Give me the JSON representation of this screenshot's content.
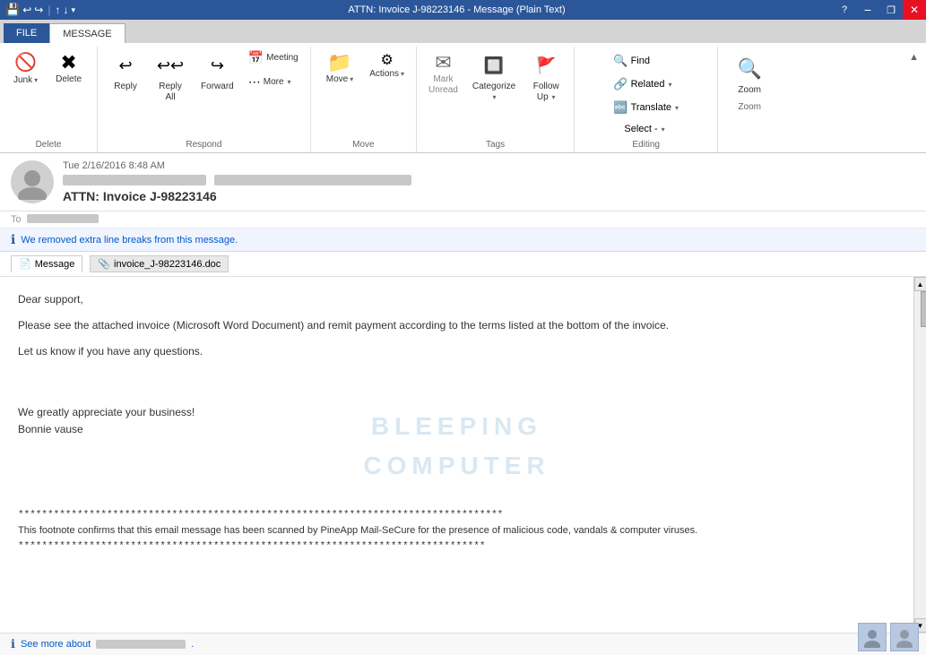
{
  "window": {
    "title": "ATTN: Invoice J-98223146 - Message (Plain Text)",
    "help_btn": "?",
    "min_btn": "−",
    "restore_btn": "❐",
    "close_btn": "✕"
  },
  "qat": {
    "save": "💾",
    "undo": "↩",
    "redo": "↪",
    "up": "↑",
    "down": "↓",
    "more": "▾"
  },
  "tabs": {
    "file": "FILE",
    "message": "MESSAGE"
  },
  "ribbon": {
    "groups": {
      "delete": {
        "label": "Delete",
        "junk_label": "Junk",
        "delete_label": "Delete"
      },
      "respond": {
        "label": "Respond",
        "reply_label": "Reply",
        "reply_all_label": "Reply All",
        "forward_label": "Forward",
        "meeting_label": "Meeting",
        "more_label": "More"
      },
      "move": {
        "label": "Move",
        "move_label": "Move",
        "actions_label": "Actions",
        "actions_arrow": "▾"
      },
      "tags": {
        "label": "Tags",
        "mark_unread_label": "Mark\nUnread",
        "categorize_label": "Categorize",
        "follow_up_label": "Follow\nUp"
      },
      "editing": {
        "label": "Editing",
        "find_label": "Find",
        "related_label": "Related",
        "related_arrow": "▾",
        "translate_label": "Translate",
        "select_label": "Select -",
        "select_arrow": "▾"
      },
      "zoom": {
        "label": "Zoom",
        "zoom_label": "Zoom"
      }
    }
  },
  "email": {
    "date": "Tue 2/16/2016 8:48 AM",
    "subject": "ATTN: Invoice J-98223146",
    "to_label": "To",
    "info_message": "We removed extra line breaks from this message.",
    "tabs": {
      "message": "Message",
      "attachment": "invoice_J-98223146.doc"
    },
    "body": {
      "greeting": "Dear support,",
      "line1": "Please see the attached invoice (Microsoft Word Document) and remit payment according to the terms listed at the bottom of the invoice.",
      "line2": "Let us know if you have any questions.",
      "line3": "",
      "line4": "",
      "closing1": "We greatly appreciate your business!",
      "closing2": "Bonnie vause",
      "separator": "**********************************************************************************",
      "footnote1": "This footnote confirms that this email message has been scanned by PineApp Mail-SeCure for the presence of malicious code, vandals & computer viruses.",
      "separator2": "*******************************************************************************"
    },
    "footer_prefix": "See more about",
    "watermark_line1": "BLEEPING",
    "watermark_line2": "COMPUTER"
  }
}
